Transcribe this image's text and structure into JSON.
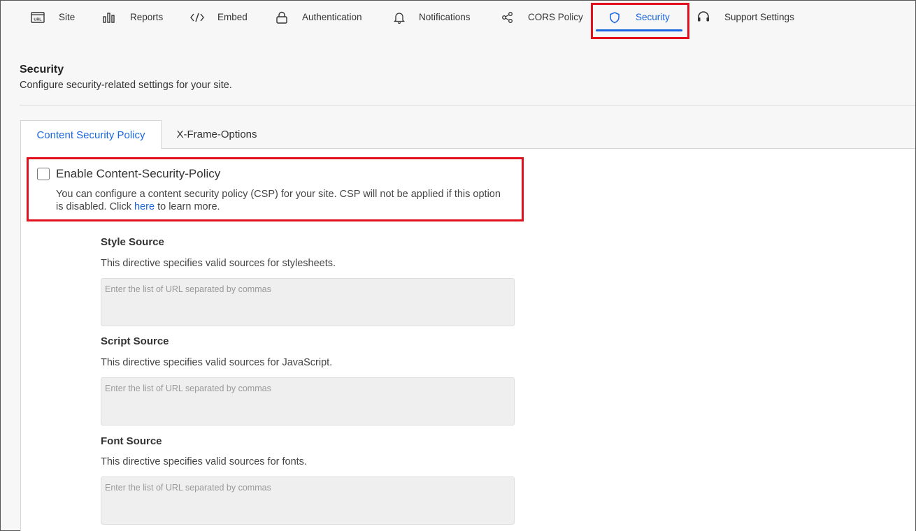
{
  "nav": {
    "items": [
      {
        "label": "Site",
        "icon": "url-icon"
      },
      {
        "label": "Reports",
        "icon": "bar-chart-icon"
      },
      {
        "label": "Embed",
        "icon": "code-icon"
      },
      {
        "label": "Authentication",
        "icon": "lock-icon"
      },
      {
        "label": "Notifications",
        "icon": "bell-icon"
      },
      {
        "label": "CORS Policy",
        "icon": "share-nodes-icon"
      },
      {
        "label": "Security",
        "icon": "shield-icon"
      },
      {
        "label": "Support Settings",
        "icon": "headset-icon"
      }
    ],
    "active": "Security"
  },
  "page": {
    "title": "Security",
    "subtitle": "Configure security-related settings for your site."
  },
  "tabs": [
    {
      "label": "Content Security Policy"
    },
    {
      "label": "X-Frame-Options"
    }
  ],
  "csp": {
    "label": "Enable Content-Security-Policy",
    "checked": false,
    "desc_before": "You can configure a content security policy (CSP) for your site. CSP will not be applied if this option is disabled. Click ",
    "link": "here",
    "desc_after": " to learn more."
  },
  "directives": [
    {
      "title": "Style Source",
      "desc": "This directive specifies valid sources for stylesheets.",
      "placeholder": "Enter the list of URL separated by commas",
      "value": ""
    },
    {
      "title": "Script Source",
      "desc": "This directive specifies valid sources for JavaScript.",
      "placeholder": "Enter the list of URL separated by commas",
      "value": ""
    },
    {
      "title": "Font Source",
      "desc": "This directive specifies valid sources for fonts.",
      "placeholder": "Enter the list of URL separated by commas",
      "value": ""
    }
  ],
  "colors": {
    "accent": "#1a66e0",
    "highlight": "#e0101c"
  }
}
